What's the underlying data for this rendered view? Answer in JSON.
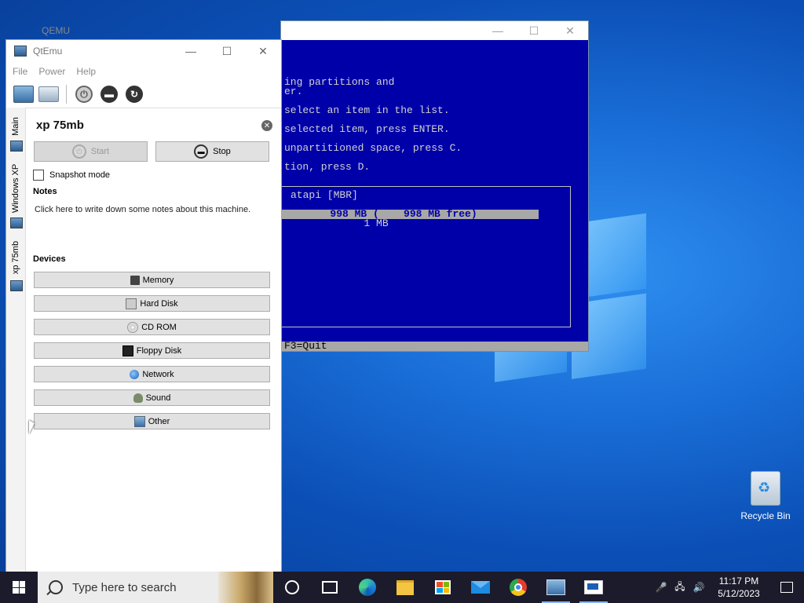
{
  "desktop": {
    "recycle_bin_label": "Recycle Bin"
  },
  "qemu_window": {
    "title": "QEMU",
    "screen_lines": [
      "ing partitions and",
      "er.",
      "select an item in the list.",
      "selected item, press ENTER.",
      "unpartitioned space, press C.",
      "tion, press D.",
      "atapi [MBR]",
      "        998 MB (    998 MB free)",
      "             1 MB"
    ],
    "status_line": "F3=Quit"
  },
  "qtemu_window": {
    "title": "QtEmu",
    "menu": [
      "File",
      "Power",
      "Help"
    ],
    "side_tabs": [
      "Main",
      "Windows XP",
      "xp 75mb"
    ],
    "vm_name": "xp 75mb",
    "start_label": "Start",
    "stop_label": "Stop",
    "snapshot_label": "Snapshot mode",
    "notes_heading": "Notes",
    "notes_text": "Click here to write down some notes about this machine.",
    "devices_heading": "Devices",
    "devices": [
      "Memory",
      "Hard Disk",
      "CD ROM",
      "Floppy Disk",
      "Network",
      "Sound",
      "Other"
    ]
  },
  "taskbar": {
    "search_placeholder": "Type here to search",
    "time": "11:17 PM",
    "date": "5/12/2023"
  }
}
